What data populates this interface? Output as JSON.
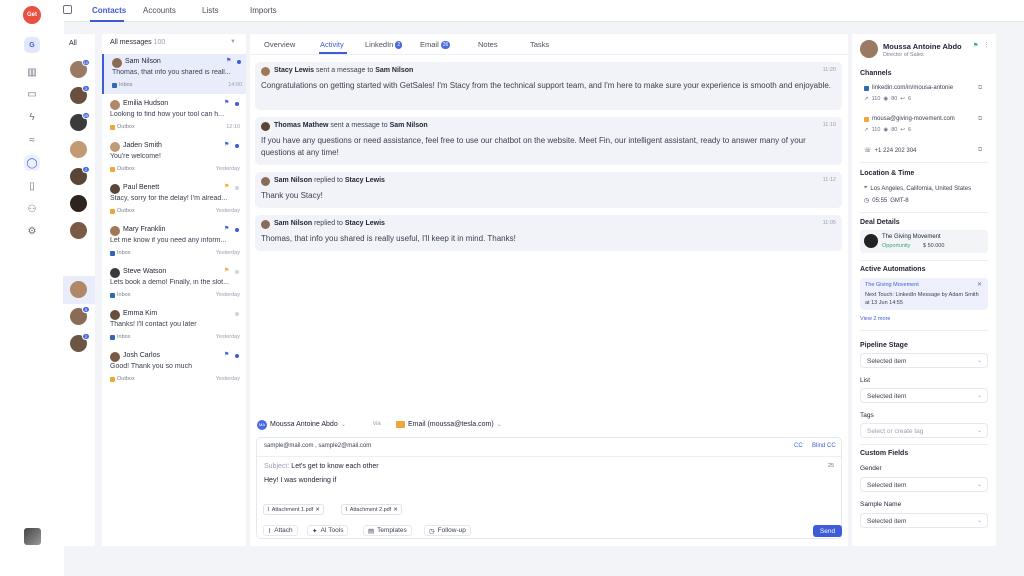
{
  "app": {
    "logo_text": "Get",
    "workspace_letter": "G"
  },
  "top_tabs": [
    {
      "label": "Contacts"
    },
    {
      "label": "Accounts"
    },
    {
      "label": "Lists"
    },
    {
      "label": "Imports"
    }
  ],
  "rail_icons": [
    "chart-icon",
    "briefcase-icon",
    "bolt-icon",
    "handshake-icon",
    "chat-icon",
    "clipboard-icon",
    "users-icon",
    "gear-icon"
  ],
  "all_column": {
    "title": "All",
    "avatars": [
      {
        "badge": "10"
      },
      {
        "badge": "3"
      },
      {
        "badge": "20"
      },
      {
        "badge": ""
      },
      {
        "badge": "2"
      },
      {
        "badge": ""
      },
      {
        "badge": ""
      },
      {
        "badge": ""
      },
      {
        "badge": "5"
      },
      {
        "badge": "2"
      }
    ]
  },
  "messages": {
    "header": "All messages",
    "count": "100",
    "items": [
      {
        "name": "Sam Nilson",
        "preview": "Thomas, that info you shared is reall...",
        "source": "Inbox",
        "time": "14:00",
        "flag": "blue",
        "dot": "filled"
      },
      {
        "name": "Emilia Hudson",
        "preview": "Looking to find how your tool can h...",
        "source": "Outbox",
        "time": "12:10",
        "flag": "blue",
        "dot": "filled"
      },
      {
        "name": "Jaden Smith",
        "preview": "You're welcome!",
        "source": "Outbox",
        "time": "Yesterday",
        "flag": "blue",
        "dot": "filled"
      },
      {
        "name": "Paul Benett",
        "preview": "Stacy, sorry for the delay! I'm alread...",
        "source": "Outbox",
        "time": "Yesterday",
        "flag": "orange",
        "dot": "empty"
      },
      {
        "name": "Mary Franklin",
        "preview": "Let me know if you need any inform...",
        "source": "Inbox",
        "time": "Yesterday",
        "flag": "blue",
        "dot": "filled"
      },
      {
        "name": "Steve Watson",
        "preview": "Lets book a demo! Finally, in the slot...",
        "source": "Inbox",
        "time": "Yesterday",
        "flag": "orange",
        "dot": "empty"
      },
      {
        "name": "Emma Kim",
        "preview": "Thanks! I'll contact you later",
        "source": "Inbox",
        "time": "Yesterday",
        "flag": "",
        "dot": "empty"
      },
      {
        "name": "Josh Carlos",
        "preview": "Good! Thank you so much",
        "source": "Outbox",
        "time": "Yesterday",
        "flag": "blue",
        "dot": "filled"
      }
    ]
  },
  "main_tabs": [
    {
      "label": "Overview",
      "badge": ""
    },
    {
      "label": "Activity",
      "badge": ""
    },
    {
      "label": "LinkedIn",
      "badge": "2"
    },
    {
      "label": "Email",
      "badge": "26"
    },
    {
      "label": "Notes",
      "badge": ""
    },
    {
      "label": "Tasks",
      "badge": ""
    }
  ],
  "activity": [
    {
      "sender": "Stacy Lewis",
      "verb": "sent a message to",
      "recipient": "Sam Nilson",
      "time": "11:20",
      "body": "Congratulations on getting started with GetSales! I'm Stacy from the technical support team, and I'm here to make sure your experience is smooth and enjoyable."
    },
    {
      "sender": "Thomas Mathew",
      "verb": "sent a message to",
      "recipient": "Sam Nilson",
      "time": "11:10",
      "body": "If you have any questions or need assistance, feel free to use our chatbot on the website. Meet Fin, our intelligent assistant, ready to answer many of your questions at any time!"
    },
    {
      "sender": "Sam Nilson",
      "verb": "replied to",
      "recipient": "Stacy Lewis",
      "time": "11:12",
      "body": "Thank you Stacy!"
    },
    {
      "sender": "Sam Nilson",
      "verb": "replied to",
      "recipient": "Stacy Lewis",
      "time": "11:05",
      "body": "Thomas, that info you shared is really useful, I'll keep it in mind. Thanks!"
    }
  ],
  "composer": {
    "from": "Moussa Antoine Abdo",
    "from_initials": "MA",
    "via": "via",
    "channel": "Email (moussa@tesla.com)",
    "to": "sample@mail.com ,  sample2@mail.com",
    "cc": "CC",
    "bcc": "Blind CC",
    "subject_label": "Subject:",
    "subject": "Let's get to know each other",
    "size": "25",
    "body": "Hey! I was wondering if",
    "attachments": [
      "Attachment 1.pdf",
      "Attachment 2.pdf"
    ],
    "tools": [
      "Attach",
      "AI Tools",
      "Templates",
      "Follow-up"
    ],
    "send": "Send"
  },
  "profile": {
    "name": "Moussa Antoine Abdo",
    "role": "Director of Sales",
    "channels_title": "Channels",
    "linkedin": "linkedin.com/in/mousa-antonie",
    "linkedin_stats": [
      "110",
      "80",
      "6"
    ],
    "email": "mousa@giving-movement.com",
    "email_stats": [
      "110",
      "80",
      "6"
    ],
    "phone": "+1 224 202 304",
    "location_title": "Location & Time",
    "location": "Los Angeles, California, United States",
    "time": "05:55",
    "timezone": "GMT-8",
    "deal_title": "Deal Details",
    "deal_name": "The Giving Movement",
    "deal_stage": "Opportunity",
    "deal_value": "$ 50.000",
    "automations_title": "Active Automations",
    "automation_name": "The Giving Movement",
    "automation_text": "Next Touch: LinkedIn Message by Adam Smith at 13 Jun 14:55",
    "view_more": "View 2 more",
    "pipeline_title": "Pipeline Stage",
    "pipeline_value": "Selected item",
    "list_label": "List",
    "list_value": "Selected item",
    "tags_label": "Tags",
    "tags_placeholder": "Select or create tag",
    "custom_title": "Custom Fields",
    "gender_label": "Gender",
    "gender_value": "Selected item",
    "sample_label": "Sample Name",
    "sample_value": "Selected item"
  }
}
